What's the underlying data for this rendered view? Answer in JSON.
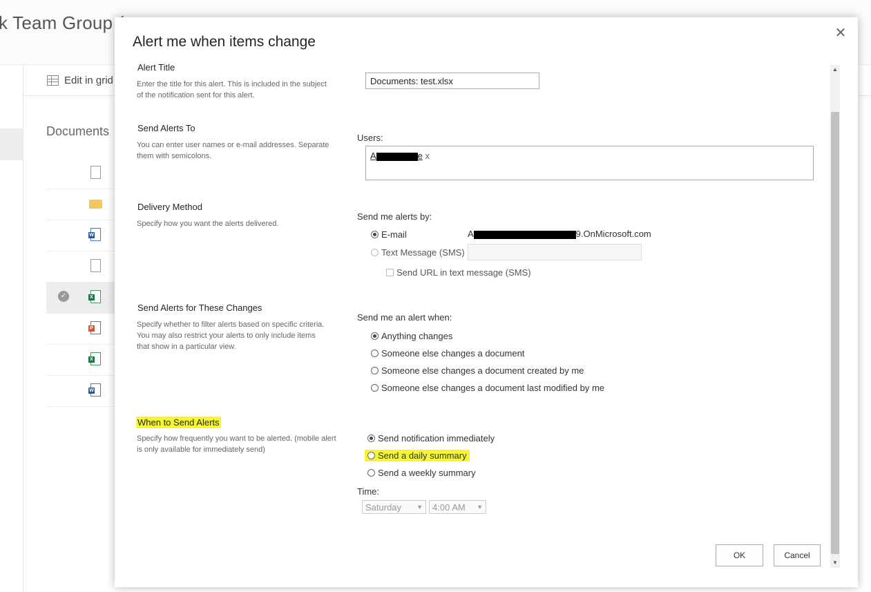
{
  "background": {
    "site_title": "k Team Group (",
    "edit_in_grid": "Edit in grid",
    "documents_label": "Documents"
  },
  "dialog": {
    "title": "Alert me when items change",
    "close_icon": "close-icon",
    "alert_title": {
      "heading": "Alert Title",
      "description": "Enter the title for this alert. This is included in the subject of the notification sent for this alert.",
      "value": "Documents: test.xlsx"
    },
    "send_alerts_to": {
      "heading": "Send Alerts To",
      "description": "You can enter user names or e-mail addresses. Separate them with semicolons.",
      "users_label": "Users:",
      "user_prefix": "A",
      "user_suffix": "e",
      "remove_mark": "x"
    },
    "delivery_method": {
      "heading": "Delivery Method",
      "description": "Specify how you want the alerts delivered.",
      "send_by_label": "Send me alerts by:",
      "email_label": "E-mail",
      "email_prefix": "A",
      "email_suffix": "9.OnMicrosoft.com",
      "sms_label": "Text Message (SMS)",
      "sms_url_label": "Send URL in text message (SMS)"
    },
    "changes": {
      "heading": "Send Alerts for These Changes",
      "description": "Specify whether to filter alerts based on specific criteria. You may also restrict your alerts to only include items that show in a particular view.",
      "when_label": "Send me an alert when:",
      "options": [
        "Anything changes",
        "Someone else changes a document",
        "Someone else changes a document created by me",
        "Someone else changes a document last modified by me"
      ]
    },
    "when_to_send": {
      "heading": "When to Send Alerts",
      "description": "Specify how frequently you want to be alerted. (mobile alert is only available for immediately send)",
      "options": [
        "Send notification immediately",
        "Send a daily summary",
        "Send a weekly summary"
      ],
      "time_label": "Time:",
      "day_value": "Saturday",
      "time_value": "4:00 AM"
    },
    "buttons": {
      "ok": "OK",
      "cancel": "Cancel"
    }
  },
  "colors": {
    "highlight": "#f5f531",
    "dialog_bg": "#ffffff",
    "scrollbar_thumb": "#c1c1c1"
  }
}
